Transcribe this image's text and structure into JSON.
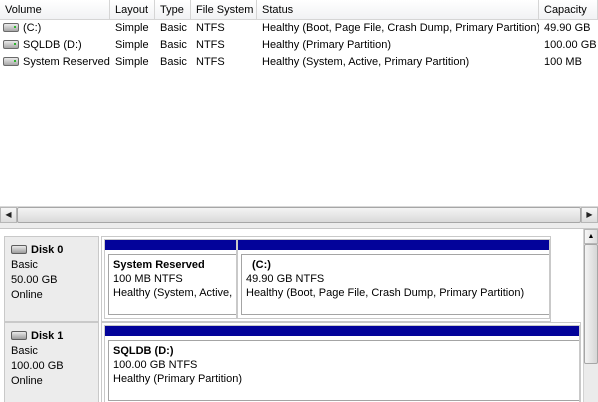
{
  "volume_list": {
    "columns": [
      "Volume",
      "Layout",
      "Type",
      "File System",
      "Status",
      "Capacity"
    ],
    "rows": [
      {
        "volume": "(C:)",
        "layout": "Simple",
        "type": "Basic",
        "fs": "NTFS",
        "status": "Healthy (Boot, Page File, Crash Dump, Primary Partition)",
        "capacity": "49.90 GB"
      },
      {
        "volume": "SQLDB (D:)",
        "layout": "Simple",
        "type": "Basic",
        "fs": "NTFS",
        "status": "Healthy (Primary Partition)",
        "capacity": "100.00 GB"
      },
      {
        "volume": "System Reserved",
        "layout": "Simple",
        "type": "Basic",
        "fs": "NTFS",
        "status": "Healthy (System, Active, Primary Partition)",
        "capacity": "100 MB"
      }
    ]
  },
  "scrollbar": {
    "left_arrow": "◀",
    "right_arrow": "▶",
    "up_arrow": "▲"
  },
  "disks": [
    {
      "name": "Disk 0",
      "type": "Basic",
      "size": "50.00 GB",
      "state": "Online",
      "partitions": [
        {
          "title": "System Reserved",
          "size_fs": "100 MB NTFS",
          "status": "Healthy (System, Active,"
        },
        {
          "title": "(C:)",
          "size_fs": "49.90 GB NTFS",
          "status": "Healthy (Boot, Page File, Crash Dump, Primary Partition)"
        }
      ]
    },
    {
      "name": "Disk 1",
      "type": "Basic",
      "size": "100.00 GB",
      "state": "Online",
      "partitions": [
        {
          "title": "SQLDB  (D:)",
          "size_fs": "100.00 GB NTFS",
          "status": "Healthy (Primary Partition)"
        }
      ]
    }
  ],
  "colors": {
    "partition_bar": "#03039a",
    "info_panel": "#ececec"
  }
}
